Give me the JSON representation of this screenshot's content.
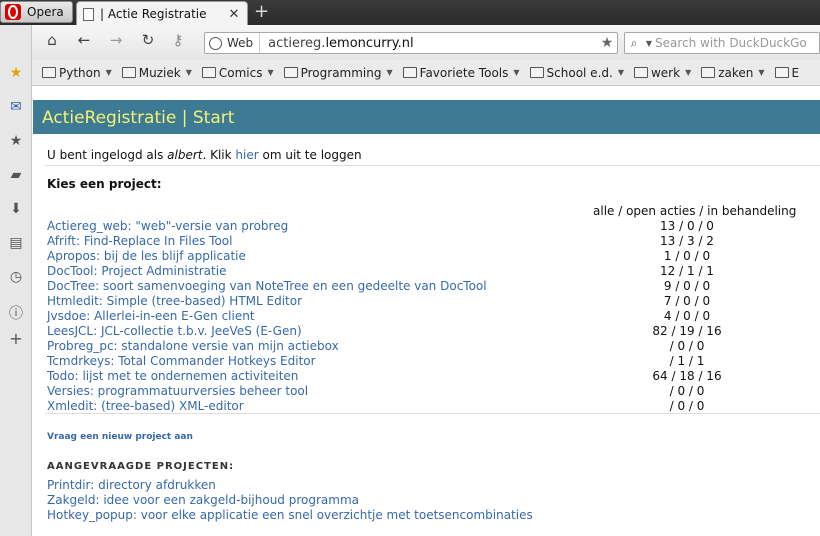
{
  "browser": {
    "menu_label": "Opera",
    "tab_title": "| Actie Registratie",
    "address": {
      "badge": "Web",
      "url_host_prefix": "actiereg.",
      "url_host_main": "lemoncurry.nl"
    },
    "search_placeholder": "Search with DuckDuckGo",
    "bookmarks": [
      "Python",
      "Muziek",
      "Comics",
      "Programming",
      "Favoriete Tools",
      "School e.d.",
      "werk",
      "zaken",
      "E"
    ]
  },
  "page": {
    "header": "ActieRegistratie | Start",
    "login": {
      "prefix": "U bent ingelogd als ",
      "user": "albert",
      "middle": ". Klik ",
      "link": "hier",
      "suffix": " om uit te loggen"
    },
    "choose_title": "Kies een project:",
    "column_header": "alle / open acties / in behandeling",
    "projects": [
      {
        "name": "Actiereg_web: \"web\"-versie van probreg",
        "counts": "13 / 0 / 0"
      },
      {
        "name": "Afrift: Find-Replace In Files Tool",
        "counts": "13 / 3 / 2"
      },
      {
        "name": "Apropos: bij de les blijf applicatie",
        "counts": "1 / 0 / 0"
      },
      {
        "name": "DocTool: Project Administratie",
        "counts": "12 / 1 / 1"
      },
      {
        "name": "DocTree: soort samenvoeging van NoteTree en een gedeelte van DocTool",
        "counts": "9 / 0 / 0"
      },
      {
        "name": "Htmledit: Simple (tree-based) HTML Editor",
        "counts": "7 / 0 / 0"
      },
      {
        "name": "Jvsdoe: Allerlei-in-een E-Gen client",
        "counts": "4 / 0 / 0"
      },
      {
        "name": "LeesJCL: JCL-collectie t.b.v. JeeVeS (E-Gen)",
        "counts": "82 / 19 / 16"
      },
      {
        "name": "Probreg_pc: standalone versie van mijn actiebox",
        "counts": "/ 0 / 0"
      },
      {
        "name": "Tcmdrkeys: Total Commander Hotkeys Editor",
        "counts": "/ 1 / 1"
      },
      {
        "name": "Todo: lijst met te ondernemen activiteiten",
        "counts": "64 / 18 / 16"
      },
      {
        "name": "Versies: programmatuurversies beheer tool",
        "counts": "/ 0 / 0"
      },
      {
        "name": "Xmledit: (tree-based) XML-editor",
        "counts": "/ 0 / 0"
      }
    ],
    "new_project_link": "Vraag een nieuw project aan",
    "requested_title": "AANGEVRAAGDE PROJECTEN:",
    "requested": [
      "Printdir: directory afdrukken",
      "Zakgeld: idee voor een zakgeld-bijhoud programma",
      "Hotkey_popup: voor elke applicatie een snel overzichtje met toetsencombinaties"
    ]
  }
}
